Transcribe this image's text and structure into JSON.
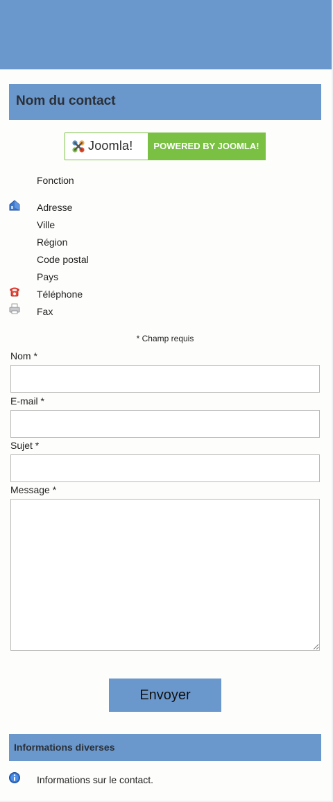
{
  "contact": {
    "title": "Nom du contact",
    "badge_brand": "Joomla!",
    "badge_text": "POWERED BY JOOMLA!",
    "position": "Fonction",
    "address_lines": {
      "address": "Adresse",
      "city": "Ville",
      "region": "Région",
      "postcode": "Code postal",
      "country": "Pays",
      "phone": "Téléphone",
      "fax": "Fax"
    }
  },
  "form": {
    "required_note": "* Champ requis",
    "name_label": "Nom *",
    "email_label": "E-mail *",
    "subject_label": "Sujet *",
    "message_label": "Message *",
    "name_value": "",
    "email_value": "",
    "subject_value": "",
    "message_value": "",
    "submit_label": "Envoyer"
  },
  "misc": {
    "title": "Informations diverses",
    "text": "Informations sur le contact."
  },
  "colors": {
    "accent": "#6b98cc",
    "joomla_green": "#7ac143",
    "background": "#fdfdfb"
  },
  "icons": {
    "address": "house-icon",
    "phone": "telephone-icon",
    "fax": "fax-icon",
    "info": "info-icon"
  }
}
